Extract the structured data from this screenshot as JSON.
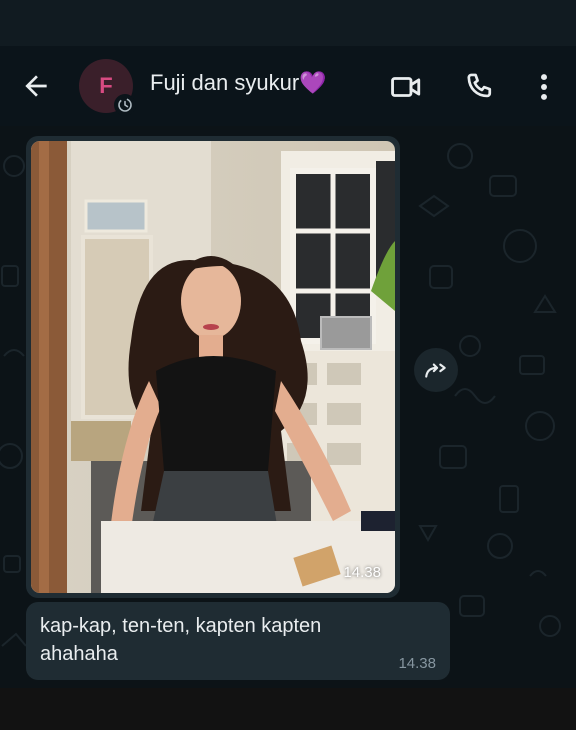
{
  "header": {
    "title": "Fuji dan syukur",
    "title_emoji": "💜",
    "avatar_initial": "F",
    "icons": [
      "back-arrow-icon",
      "video-call-icon",
      "voice-call-icon",
      "more-vertical-icon"
    ]
  },
  "messages": [
    {
      "type": "image",
      "time": "14.38"
    },
    {
      "type": "text",
      "text": "kap-kap, ten-ten, kapten kapten ahahaha",
      "time": "14.38"
    }
  ],
  "colors": {
    "bubble": "#1f2c33",
    "chat_background": "#0c1317",
    "header_background": "#0b141a",
    "accent_avatar": "#d84b82"
  }
}
